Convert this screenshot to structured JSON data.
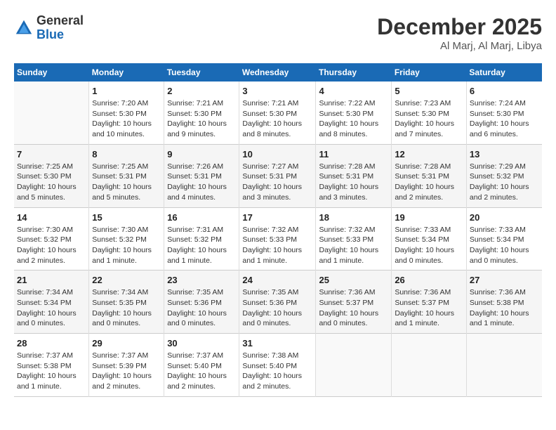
{
  "header": {
    "logo": {
      "general": "General",
      "blue": "Blue"
    },
    "month": "December 2025",
    "location": "Al Marj, Al Marj, Libya"
  },
  "weekdays": [
    "Sunday",
    "Monday",
    "Tuesday",
    "Wednesday",
    "Thursday",
    "Friday",
    "Saturday"
  ],
  "weeks": [
    [
      {
        "day": "",
        "sunrise": "",
        "sunset": "",
        "daylight": ""
      },
      {
        "day": "1",
        "sunrise": "Sunrise: 7:20 AM",
        "sunset": "Sunset: 5:30 PM",
        "daylight": "Daylight: 10 hours and 10 minutes."
      },
      {
        "day": "2",
        "sunrise": "Sunrise: 7:21 AM",
        "sunset": "Sunset: 5:30 PM",
        "daylight": "Daylight: 10 hours and 9 minutes."
      },
      {
        "day": "3",
        "sunrise": "Sunrise: 7:21 AM",
        "sunset": "Sunset: 5:30 PM",
        "daylight": "Daylight: 10 hours and 8 minutes."
      },
      {
        "day": "4",
        "sunrise": "Sunrise: 7:22 AM",
        "sunset": "Sunset: 5:30 PM",
        "daylight": "Daylight: 10 hours and 8 minutes."
      },
      {
        "day": "5",
        "sunrise": "Sunrise: 7:23 AM",
        "sunset": "Sunset: 5:30 PM",
        "daylight": "Daylight: 10 hours and 7 minutes."
      },
      {
        "day": "6",
        "sunrise": "Sunrise: 7:24 AM",
        "sunset": "Sunset: 5:30 PM",
        "daylight": "Daylight: 10 hours and 6 minutes."
      }
    ],
    [
      {
        "day": "7",
        "sunrise": "Sunrise: 7:25 AM",
        "sunset": "Sunset: 5:30 PM",
        "daylight": "Daylight: 10 hours and 5 minutes."
      },
      {
        "day": "8",
        "sunrise": "Sunrise: 7:25 AM",
        "sunset": "Sunset: 5:31 PM",
        "daylight": "Daylight: 10 hours and 5 minutes."
      },
      {
        "day": "9",
        "sunrise": "Sunrise: 7:26 AM",
        "sunset": "Sunset: 5:31 PM",
        "daylight": "Daylight: 10 hours and 4 minutes."
      },
      {
        "day": "10",
        "sunrise": "Sunrise: 7:27 AM",
        "sunset": "Sunset: 5:31 PM",
        "daylight": "Daylight: 10 hours and 3 minutes."
      },
      {
        "day": "11",
        "sunrise": "Sunrise: 7:28 AM",
        "sunset": "Sunset: 5:31 PM",
        "daylight": "Daylight: 10 hours and 3 minutes."
      },
      {
        "day": "12",
        "sunrise": "Sunrise: 7:28 AM",
        "sunset": "Sunset: 5:31 PM",
        "daylight": "Daylight: 10 hours and 2 minutes."
      },
      {
        "day": "13",
        "sunrise": "Sunrise: 7:29 AM",
        "sunset": "Sunset: 5:32 PM",
        "daylight": "Daylight: 10 hours and 2 minutes."
      }
    ],
    [
      {
        "day": "14",
        "sunrise": "Sunrise: 7:30 AM",
        "sunset": "Sunset: 5:32 PM",
        "daylight": "Daylight: 10 hours and 2 minutes."
      },
      {
        "day": "15",
        "sunrise": "Sunrise: 7:30 AM",
        "sunset": "Sunset: 5:32 PM",
        "daylight": "Daylight: 10 hours and 1 minute."
      },
      {
        "day": "16",
        "sunrise": "Sunrise: 7:31 AM",
        "sunset": "Sunset: 5:32 PM",
        "daylight": "Daylight: 10 hours and 1 minute."
      },
      {
        "day": "17",
        "sunrise": "Sunrise: 7:32 AM",
        "sunset": "Sunset: 5:33 PM",
        "daylight": "Daylight: 10 hours and 1 minute."
      },
      {
        "day": "18",
        "sunrise": "Sunrise: 7:32 AM",
        "sunset": "Sunset: 5:33 PM",
        "daylight": "Daylight: 10 hours and 1 minute."
      },
      {
        "day": "19",
        "sunrise": "Sunrise: 7:33 AM",
        "sunset": "Sunset: 5:34 PM",
        "daylight": "Daylight: 10 hours and 0 minutes."
      },
      {
        "day": "20",
        "sunrise": "Sunrise: 7:33 AM",
        "sunset": "Sunset: 5:34 PM",
        "daylight": "Daylight: 10 hours and 0 minutes."
      }
    ],
    [
      {
        "day": "21",
        "sunrise": "Sunrise: 7:34 AM",
        "sunset": "Sunset: 5:34 PM",
        "daylight": "Daylight: 10 hours and 0 minutes."
      },
      {
        "day": "22",
        "sunrise": "Sunrise: 7:34 AM",
        "sunset": "Sunset: 5:35 PM",
        "daylight": "Daylight: 10 hours and 0 minutes."
      },
      {
        "day": "23",
        "sunrise": "Sunrise: 7:35 AM",
        "sunset": "Sunset: 5:36 PM",
        "daylight": "Daylight: 10 hours and 0 minutes."
      },
      {
        "day": "24",
        "sunrise": "Sunrise: 7:35 AM",
        "sunset": "Sunset: 5:36 PM",
        "daylight": "Daylight: 10 hours and 0 minutes."
      },
      {
        "day": "25",
        "sunrise": "Sunrise: 7:36 AM",
        "sunset": "Sunset: 5:37 PM",
        "daylight": "Daylight: 10 hours and 0 minutes."
      },
      {
        "day": "26",
        "sunrise": "Sunrise: 7:36 AM",
        "sunset": "Sunset: 5:37 PM",
        "daylight": "Daylight: 10 hours and 1 minute."
      },
      {
        "day": "27",
        "sunrise": "Sunrise: 7:36 AM",
        "sunset": "Sunset: 5:38 PM",
        "daylight": "Daylight: 10 hours and 1 minute."
      }
    ],
    [
      {
        "day": "28",
        "sunrise": "Sunrise: 7:37 AM",
        "sunset": "Sunset: 5:38 PM",
        "daylight": "Daylight: 10 hours and 1 minute."
      },
      {
        "day": "29",
        "sunrise": "Sunrise: 7:37 AM",
        "sunset": "Sunset: 5:39 PM",
        "daylight": "Daylight: 10 hours and 2 minutes."
      },
      {
        "day": "30",
        "sunrise": "Sunrise: 7:37 AM",
        "sunset": "Sunset: 5:40 PM",
        "daylight": "Daylight: 10 hours and 2 minutes."
      },
      {
        "day": "31",
        "sunrise": "Sunrise: 7:38 AM",
        "sunset": "Sunset: 5:40 PM",
        "daylight": "Daylight: 10 hours and 2 minutes."
      },
      {
        "day": "",
        "sunrise": "",
        "sunset": "",
        "daylight": ""
      },
      {
        "day": "",
        "sunrise": "",
        "sunset": "",
        "daylight": ""
      },
      {
        "day": "",
        "sunrise": "",
        "sunset": "",
        "daylight": ""
      }
    ]
  ]
}
